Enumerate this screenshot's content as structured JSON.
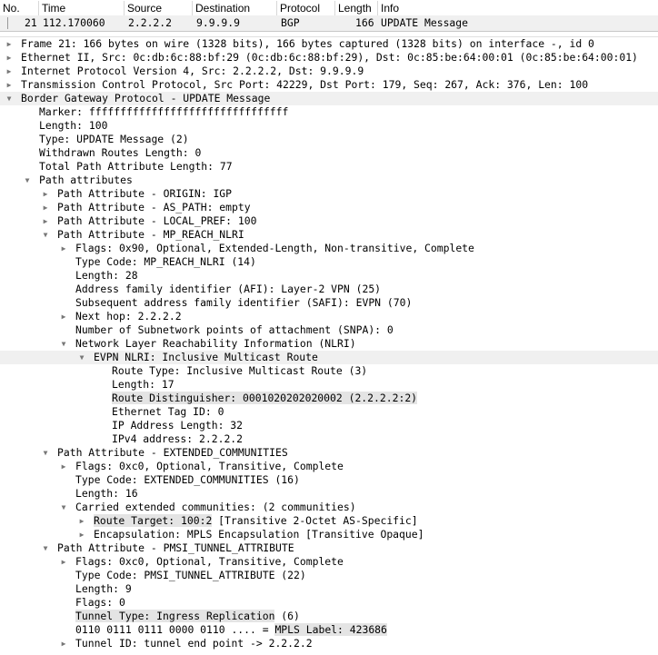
{
  "packet_list": {
    "columns": [
      "No.",
      "Time",
      "Source",
      "Destination",
      "Protocol",
      "Length",
      "Info"
    ],
    "row": {
      "no": "21",
      "time": "112.170060",
      "source": "2.2.2.2",
      "destination": "9.9.9.9",
      "protocol": "BGP",
      "length": "166",
      "info": "UPDATE Message"
    }
  },
  "details": [
    {
      "level": 0,
      "arrow": "collapsed",
      "text": "Frame 21: 166 bytes on wire (1328 bits), 166 bytes captured (1328 bits) on interface -, id 0"
    },
    {
      "level": 0,
      "arrow": "collapsed",
      "text": "Ethernet II, Src: 0c:db:6c:88:bf:29 (0c:db:6c:88:bf:29), Dst: 0c:85:be:64:00:01 (0c:85:be:64:00:01)"
    },
    {
      "level": 0,
      "arrow": "collapsed",
      "text": "Internet Protocol Version 4, Src: 2.2.2.2, Dst: 9.9.9.9"
    },
    {
      "level": 0,
      "arrow": "collapsed",
      "text": "Transmission Control Protocol, Src Port: 42229, Dst Port: 179, Seq: 267, Ack: 376, Len: 100"
    },
    {
      "level": 0,
      "arrow": "expanded",
      "text": "Border Gateway Protocol - UPDATE Message",
      "selected": true
    },
    {
      "level": 1,
      "arrow": "none",
      "text": "Marker: ffffffffffffffffffffffffffffffff"
    },
    {
      "level": 1,
      "arrow": "none",
      "text": "Length: 100"
    },
    {
      "level": 1,
      "arrow": "none",
      "text": "Type: UPDATE Message (2)"
    },
    {
      "level": 1,
      "arrow": "none",
      "text": "Withdrawn Routes Length: 0"
    },
    {
      "level": 1,
      "arrow": "none",
      "text": "Total Path Attribute Length: 77"
    },
    {
      "level": 1,
      "arrow": "expanded",
      "text": "Path attributes"
    },
    {
      "level": 2,
      "arrow": "collapsed",
      "text": "Path Attribute - ORIGIN: IGP"
    },
    {
      "level": 2,
      "arrow": "collapsed",
      "text": "Path Attribute - AS_PATH: empty"
    },
    {
      "level": 2,
      "arrow": "collapsed",
      "text": "Path Attribute - LOCAL_PREF: 100"
    },
    {
      "level": 2,
      "arrow": "expanded",
      "text": "Path Attribute - MP_REACH_NLRI"
    },
    {
      "level": 3,
      "arrow": "collapsed",
      "text": "Flags: 0x90, Optional, Extended-Length, Non-transitive, Complete"
    },
    {
      "level": 3,
      "arrow": "none",
      "text": "Type Code: MP_REACH_NLRI (14)"
    },
    {
      "level": 3,
      "arrow": "none",
      "text": "Length: 28"
    },
    {
      "level": 3,
      "arrow": "none",
      "text": "Address family identifier (AFI): Layer-2 VPN (25)"
    },
    {
      "level": 3,
      "arrow": "none",
      "text": "Subsequent address family identifier (SAFI): EVPN (70)"
    },
    {
      "level": 3,
      "arrow": "collapsed",
      "text": "Next hop: 2.2.2.2"
    },
    {
      "level": 3,
      "arrow": "none",
      "text": "Number of Subnetwork points of attachment (SNPA): 0"
    },
    {
      "level": 3,
      "arrow": "expanded",
      "text": "Network Layer Reachability Information (NLRI)"
    },
    {
      "level": 4,
      "arrow": "expanded",
      "text": "EVPN NLRI: Inclusive Multicast Route",
      "selected": true
    },
    {
      "level": 5,
      "arrow": "none",
      "text": "Route Type: Inclusive Multicast Route (3)"
    },
    {
      "level": 5,
      "arrow": "none",
      "text": "Length: 17"
    },
    {
      "level": 5,
      "arrow": "none",
      "text": "Route Distinguisher: 0001020202020002 (2.2.2.2:2)",
      "highlight": "Route Distinguisher: 0001020202020002 (2.2.2.2:2)"
    },
    {
      "level": 5,
      "arrow": "none",
      "text": "Ethernet Tag ID: 0"
    },
    {
      "level": 5,
      "arrow": "none",
      "text": "IP Address Length: 32"
    },
    {
      "level": 5,
      "arrow": "none",
      "text": "IPv4 address: 2.2.2.2"
    },
    {
      "level": 2,
      "arrow": "expanded",
      "text": "Path Attribute - EXTENDED_COMMUNITIES"
    },
    {
      "level": 3,
      "arrow": "collapsed",
      "text": "Flags: 0xc0, Optional, Transitive, Complete"
    },
    {
      "level": 3,
      "arrow": "none",
      "text": "Type Code: EXTENDED_COMMUNITIES (16)"
    },
    {
      "level": 3,
      "arrow": "none",
      "text": "Length: 16"
    },
    {
      "level": 3,
      "arrow": "expanded",
      "text": "Carried extended communities: (2 communities)"
    },
    {
      "level": 4,
      "arrow": "collapsed",
      "text": "Route Target: 100:2 [Transitive 2-Octet AS-Specific]",
      "highlight": "Route Target: 100:2"
    },
    {
      "level": 4,
      "arrow": "collapsed",
      "text": "Encapsulation: MPLS Encapsulation [Transitive Opaque]"
    },
    {
      "level": 2,
      "arrow": "expanded",
      "text": "Path Attribute - PMSI_TUNNEL_ATTRIBUTE"
    },
    {
      "level": 3,
      "arrow": "collapsed",
      "text": "Flags: 0xc0, Optional, Transitive, Complete"
    },
    {
      "level": 3,
      "arrow": "none",
      "text": "Type Code: PMSI_TUNNEL_ATTRIBUTE (22)"
    },
    {
      "level": 3,
      "arrow": "none",
      "text": "Length: 9"
    },
    {
      "level": 3,
      "arrow": "none",
      "text": "Flags: 0"
    },
    {
      "level": 3,
      "arrow": "none",
      "text": "Tunnel Type: Ingress Replication (6)",
      "highlight": "Tunnel Type: Ingress Replication"
    },
    {
      "level": 3,
      "arrow": "none",
      "text": "0110 0111 0111 0000 0110 .... = MPLS Label: 423686",
      "highlight_suffix": "MPLS Label: 423686"
    },
    {
      "level": 3,
      "arrow": "collapsed",
      "text": "Tunnel ID: tunnel end point -> 2.2.2.2"
    }
  ],
  "icons": {
    "collapsed": "triangle-right-icon",
    "expanded": "triangle-down-icon"
  }
}
